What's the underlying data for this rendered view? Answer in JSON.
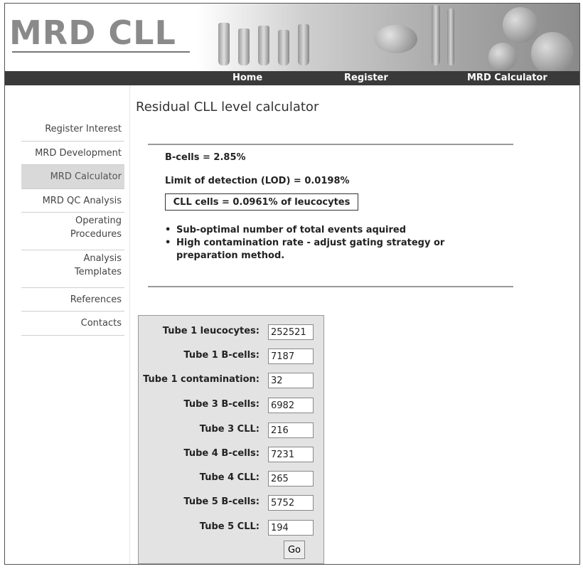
{
  "header": {
    "logo": "MRD CLL",
    "nav": [
      "Home",
      "Register",
      "MRD Calculator"
    ]
  },
  "sidebar": {
    "items": [
      {
        "label": "Register Interest"
      },
      {
        "label": "MRD Development"
      },
      {
        "label": "MRD Calculator",
        "active": true
      },
      {
        "label": "MRD QC Analysis"
      },
      {
        "label": "Operating Procedures"
      },
      {
        "label": "Analysis Templates"
      },
      {
        "label": "References"
      },
      {
        "label": "Contacts"
      }
    ]
  },
  "main": {
    "title": "Residual CLL level calculator",
    "results": {
      "bcells": "B-cells = 2.85%",
      "lod": "Limit of detection (LOD) = 0.0198%",
      "cll": "CLL cells = 0.0961% of leucocytes"
    },
    "warnings": [
      "Sub-optimal number of total events aquired",
      "High contamination rate - adjust gating strategy or preparation method."
    ]
  },
  "form": {
    "fields": [
      {
        "label": "Tube 1 leucocytes:",
        "value": "252521"
      },
      {
        "label": "Tube 1 B-cells:",
        "value": "7187"
      },
      {
        "label": "Tube 1 contamination:",
        "value": "32"
      },
      {
        "label": "Tube 3 B-cells:",
        "value": "6982"
      },
      {
        "label": "Tube 3 CLL:",
        "value": "216"
      },
      {
        "label": "Tube 4 B-cells:",
        "value": "7231"
      },
      {
        "label": "Tube 4 CLL:",
        "value": "265"
      },
      {
        "label": "Tube 5 B-cells:",
        "value": "5752"
      },
      {
        "label": "Tube 5 CLL:",
        "value": "194"
      }
    ],
    "submit_label": "Go"
  }
}
